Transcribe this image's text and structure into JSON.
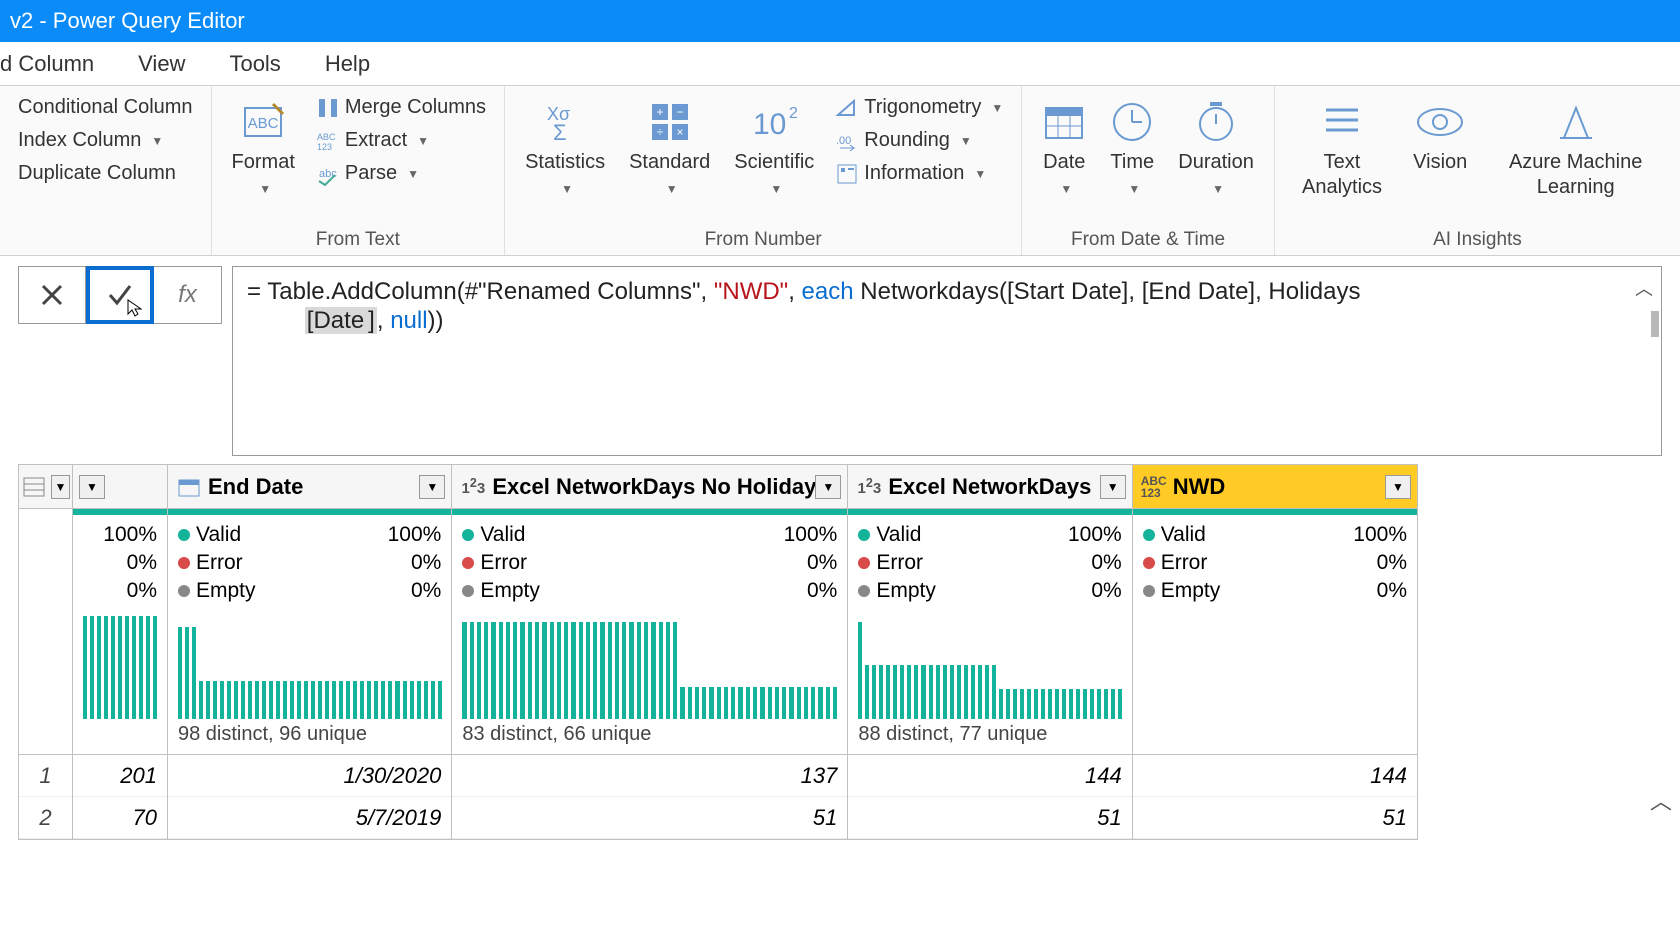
{
  "title": "v2 - Power Query Editor",
  "tabs": {
    "partial": "d Column",
    "view": "View",
    "tools": "Tools",
    "help": "Help"
  },
  "ribbon": {
    "g1": {
      "conditional": "Conditional Column",
      "index": "Index Column",
      "duplicate": "Duplicate Column"
    },
    "g2": {
      "format": "Format",
      "merge": "Merge Columns",
      "extract": "Extract",
      "parse": "Parse",
      "label": "From Text"
    },
    "g3": {
      "statistics": "Statistics",
      "standard": "Standard",
      "scientific": "Scientific",
      "trig": "Trigonometry",
      "rounding": "Rounding",
      "info": "Information",
      "label": "From Number"
    },
    "g4": {
      "date": "Date",
      "time": "Time",
      "duration": "Duration",
      "label": "From Date & Time"
    },
    "g5": {
      "text": "Text Analytics",
      "vision": "Vision",
      "azure": "Azure Machine Learning",
      "label": "AI Insights"
    }
  },
  "formula": {
    "prefix": "= Table.AddColumn(#\"Renamed Columns\", ",
    "str": "\"NWD\"",
    "mid1": ", ",
    "each": "each",
    "mid2": " Networkdays([Start Date], [End Date], Holidays",
    "line2a": "[Date",
    "line2b": "]",
    "line2c": ", ",
    "null": "null",
    "line2d": "))"
  },
  "columns": [
    {
      "name": "",
      "type": "idx"
    },
    {
      "name": "",
      "type": "num_partial",
      "profile": {
        "valid_pct": "100%",
        "error_pct": "0%",
        "empty_pct": "0%"
      },
      "hist": [
        95,
        95,
        95,
        95,
        95,
        95,
        95,
        95,
        95,
        95,
        95
      ],
      "distinct": ""
    },
    {
      "name": "End Date",
      "type": "date",
      "profile": {
        "valid": "Valid",
        "valid_pct": "100%",
        "error": "Error",
        "error_pct": "0%",
        "empty": "Empty",
        "empty_pct": "0%"
      },
      "hist": [
        85,
        85,
        85,
        35,
        35,
        35,
        35,
        35,
        35,
        35,
        35,
        35,
        35,
        35,
        35,
        35,
        35,
        35,
        35,
        35,
        35,
        35,
        35,
        35,
        35,
        35,
        35,
        35,
        35,
        35,
        35,
        35,
        35,
        35,
        35,
        35,
        35,
        35
      ],
      "distinct": "98 distinct, 96 unique"
    },
    {
      "name": "Excel NetworkDays No Holidays",
      "type": "int",
      "profile": {
        "valid": "Valid",
        "valid_pct": "100%",
        "error": "Error",
        "error_pct": "0%",
        "empty": "Empty",
        "empty_pct": "0%"
      },
      "hist": [
        90,
        90,
        90,
        90,
        90,
        90,
        90,
        90,
        90,
        90,
        90,
        90,
        90,
        90,
        90,
        90,
        90,
        90,
        90,
        90,
        90,
        90,
        90,
        90,
        90,
        90,
        90,
        90,
        90,
        90,
        30,
        30,
        30,
        30,
        30,
        30,
        30,
        30,
        30,
        30,
        30,
        30,
        30,
        30,
        30,
        30,
        30,
        30,
        30,
        30,
        30,
        30
      ],
      "distinct": "83 distinct, 66 unique"
    },
    {
      "name": "Excel NetworkDays",
      "type": "int",
      "profile": {
        "valid": "Valid",
        "valid_pct": "100%",
        "error": "Error",
        "error_pct": "0%",
        "empty": "Empty",
        "empty_pct": "0%"
      },
      "hist": [
        90,
        50,
        50,
        50,
        50,
        50,
        50,
        50,
        50,
        50,
        50,
        50,
        50,
        50,
        50,
        50,
        50,
        50,
        50,
        50,
        28,
        28,
        28,
        28,
        28,
        28,
        28,
        28,
        28,
        28,
        28,
        28,
        28,
        28,
        28,
        28,
        28,
        28
      ],
      "distinct": "88 distinct, 77 unique"
    },
    {
      "name": "NWD",
      "type": "any",
      "selected": true,
      "profile": {
        "valid": "Valid",
        "valid_pct": "100%",
        "error": "Error",
        "error_pct": "0%",
        "empty": "Empty",
        "empty_pct": "0%"
      },
      "hist": [],
      "distinct": ""
    }
  ],
  "rows": [
    {
      "idx": "1",
      "c0": "201",
      "c1": "1/30/2020",
      "c2": "137",
      "c3": "144",
      "c4": "144"
    },
    {
      "idx": "2",
      "c0": "70",
      "c1": "5/7/2019",
      "c2": "51",
      "c3": "51",
      "c4": "51"
    }
  ]
}
